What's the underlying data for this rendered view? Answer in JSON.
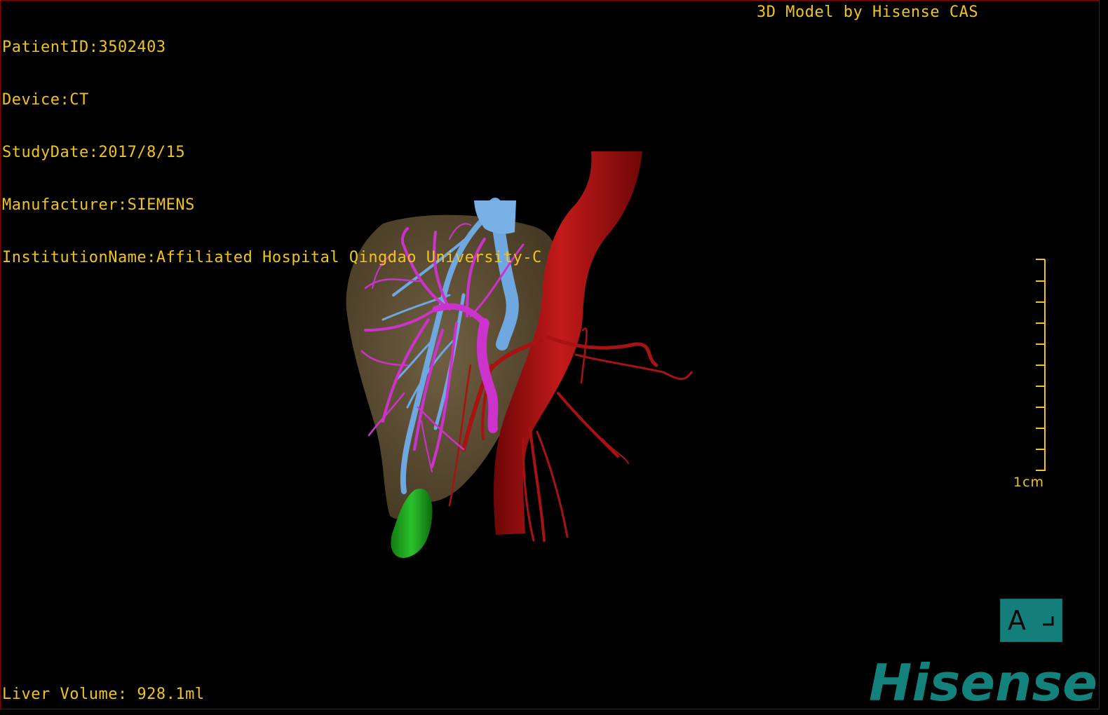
{
  "patient_info": {
    "patient_id": "PatientID:3502403",
    "device": "Device:CT",
    "study_date": "StudyDate:2017/8/15",
    "manufacturer": "Manufacturer:SIEMENS",
    "institution": "InstitutionName:Affiliated Hospital Qingdao University-C"
  },
  "credit": "3D Model by Hisense CAS",
  "liver_volume": "Liver Volume: 928.1ml",
  "scale": {
    "label": "1cm"
  },
  "orientation": {
    "letter": "A"
  },
  "logo": {
    "text": "Hisense"
  },
  "colors": {
    "overlay_text": "#f0c419",
    "liver": "#6b5a3a",
    "artery": "#b01010",
    "portal_vein": "#cc33cc",
    "hepatic_vein": "#6fa8e0",
    "gallbladder": "#1aa01a",
    "brand": "#14827c"
  }
}
